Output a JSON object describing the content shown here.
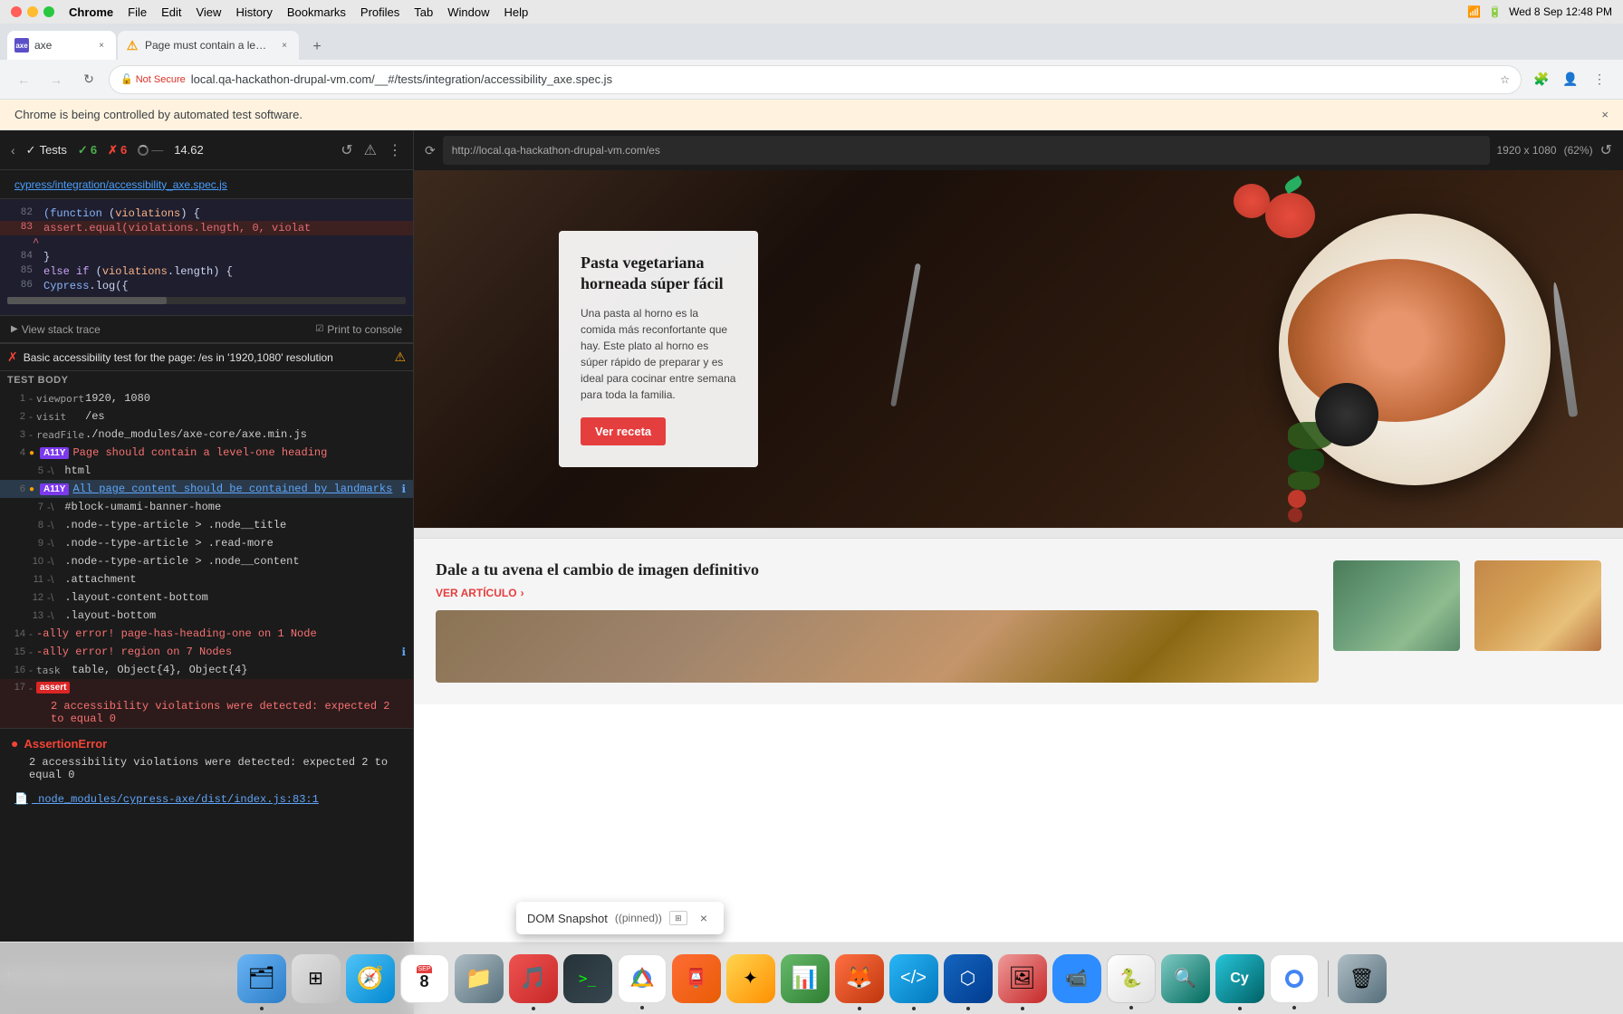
{
  "menubar": {
    "apple": "🍎",
    "chrome_label": "Chrome",
    "items": [
      "Chrome",
      "File",
      "Edit",
      "View",
      "History",
      "Bookmarks",
      "Profiles",
      "Tab",
      "Window",
      "Help"
    ],
    "clock": "Wed 8 Sep  12:48 PM"
  },
  "tabs": [
    {
      "id": "axe",
      "label": "axe",
      "active": true,
      "favicon_type": "axe"
    },
    {
      "id": "page-warning",
      "label": "Page must contain a level-one ...",
      "active": false,
      "favicon_type": "warning"
    }
  ],
  "toolbar": {
    "not_secure": "Not Secure",
    "url": "local.qa-hackathon-drupal-vm.com/__#/tests/integration/accessibility_axe.spec.js",
    "protocol": "http"
  },
  "notification": {
    "text": "Chrome is being controlled by automated test software."
  },
  "cypress": {
    "tests_label": "Tests",
    "pass_count": "6",
    "fail_count": "6",
    "time": "14.62",
    "file_path": "cypress/integration/accessibility_axe.spec.js",
    "code_lines": [
      {
        "num": "82",
        "content": "    (function (violations) {"
      },
      {
        "num": "83",
        "content": "              assert.equal(violations.length, 0, violat",
        "highlighted": true
      },
      {
        "num": "",
        "content": "      ^"
      },
      {
        "num": "84",
        "content": "        }"
      },
      {
        "num": "85",
        "content": "        else if (violations.length) {"
      },
      {
        "num": "86",
        "content": "                Cypress.log({"
      }
    ],
    "view_stack_trace": "View stack trace",
    "print_to_console": "Print to console",
    "test_fail": {
      "test_name": "Basic accessibility test for the page: /es in '1920,1080' resolution",
      "rows": [
        {
          "num": "",
          "icon": "section",
          "text": "TEST BODY"
        },
        {
          "num": "1",
          "icon": "-",
          "label": "viewport",
          "value": "1920, 1080"
        },
        {
          "num": "2",
          "icon": "-",
          "label": "visit",
          "value": "/es"
        },
        {
          "num": "3",
          "icon": "-",
          "label": "readFile",
          "value": "./node_modules/axe-core/axe.min.js"
        },
        {
          "num": "4",
          "icon": "ally",
          "label": "A11Y",
          "value": "Page should contain a level-one heading",
          "tag": "A11Y"
        },
        {
          "num": "5",
          "icon": "-",
          "label": "",
          "value": "html",
          "indent": 1
        },
        {
          "num": "6",
          "icon": "ally",
          "label": "A11Y",
          "value": "All page content should be contained by landmarks",
          "tag": "A11Y",
          "is_link": true,
          "selected": true
        },
        {
          "num": "7",
          "icon": "-",
          "label": "",
          "value": "#block-umami-banner-home",
          "indent": 1
        },
        {
          "num": "8",
          "icon": "-",
          "label": "",
          "value": ".node--type-article > .node__title",
          "indent": 1
        },
        {
          "num": "9",
          "icon": "-",
          "label": "",
          "value": ".node--type-article > .read-more",
          "indent": 1
        },
        {
          "num": "10",
          "icon": "-",
          "label": "",
          "value": ".node--type-article > .node__content",
          "indent": 1
        },
        {
          "num": "11",
          "icon": "-",
          "label": "",
          "value": ".attachment",
          "indent": 1
        },
        {
          "num": "12",
          "icon": "-",
          "label": "",
          "value": ".layout-content-bottom",
          "indent": 1
        },
        {
          "num": "13",
          "icon": "-",
          "label": "",
          "value": ".layout-bottom",
          "indent": 1
        },
        {
          "num": "14",
          "icon": "-",
          "label": "-ally error!",
          "value": "page-has-heading-one on 1 Node",
          "is_error": true
        },
        {
          "num": "15",
          "icon": "-",
          "label": "-ally error!",
          "value": "region on 7 Nodes",
          "is_error": true
        },
        {
          "num": "16",
          "icon": "-",
          "label": "task",
          "value": "table, Object{4}, Object{4}"
        },
        {
          "num": "17",
          "icon": "assert",
          "label": "assert",
          "value": "2 accessibility violations were detected: expected 2 to equal 0",
          "is_error": true,
          "tag": "assert"
        }
      ]
    },
    "assertion_error": {
      "label": "AssertionError",
      "message": "2 accessibility violations were detected: expected 2 to equal 0"
    },
    "error_file": "node_modules/cypress-axe/dist/index.js:83:1"
  },
  "preview": {
    "url": "http://local.qa-hackathon-drupal-vm.com/es",
    "dimensions": "1920 x 1080",
    "zoom": "62%",
    "hero": {
      "title": "Pasta vegetariana horneada súper fácil",
      "description": "Una pasta al horno es la comida más reconfortante que hay. Este plato al horno es súper rápido de preparar y es ideal para cocinar entre semana para toda la familia.",
      "button": "Ver receta"
    },
    "articles": {
      "main_title": "Dale a tu avena el cambio de imagen definitivo",
      "main_link": "VER ARTÍCULO"
    }
  },
  "dom_snapshot": {
    "label": "DOM Snapshot",
    "tag": "(pinned)"
  },
  "tooltip": {
    "url": "https://dequeuniversity.com/rules/axe/4.3/region?application=axeAPI"
  }
}
